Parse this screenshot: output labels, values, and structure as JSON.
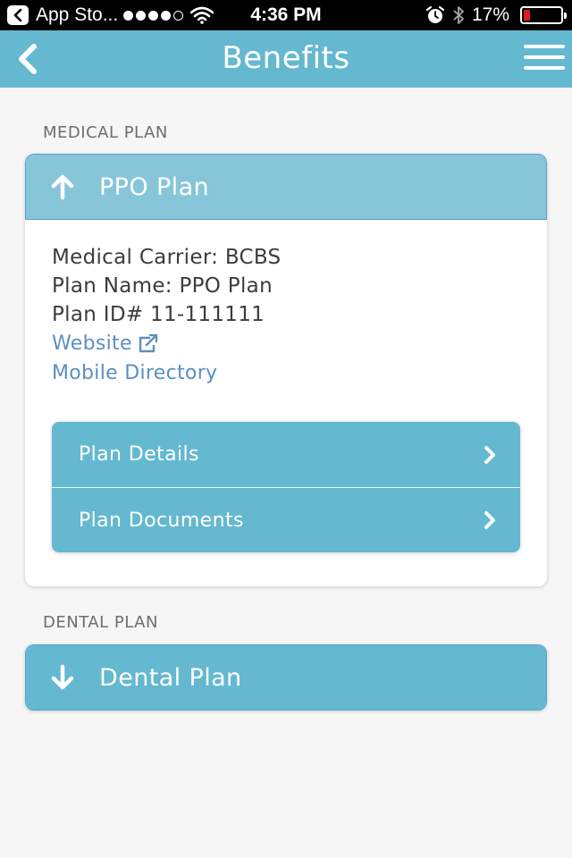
{
  "status_bar": {
    "back_app": "App Sto...",
    "time": "4:36 PM",
    "battery_text": "17%",
    "battery_level": 0.17,
    "signal_bars_filled": 4,
    "signal_bars_total": 5,
    "icons": [
      "back-arrow-icon",
      "wifi-icon",
      "alarm-icon",
      "bluetooth-icon",
      "battery-icon"
    ]
  },
  "nav": {
    "title": "Benefits",
    "back_icon": "chevron-left-icon",
    "menu_icon": "hamburger-menu-icon"
  },
  "medical": {
    "section_label": "MEDICAL PLAN",
    "header": "PPO Plan",
    "header_icon": "arrow-up-icon",
    "carrier": "Medical Carrier: BCBS",
    "plan_name": "Plan Name: PPO Plan",
    "plan_id": "Plan ID# 11-111111",
    "website_link": "Website",
    "website_icon": "external-link-icon",
    "mobile_directory_link": "Mobile Directory",
    "actions": [
      {
        "label": "Plan Details",
        "icon": "chevron-right-icon"
      },
      {
        "label": "Plan Documents",
        "icon": "chevron-right-icon"
      }
    ]
  },
  "dental": {
    "section_label": "DENTAL PLAN",
    "header": "Dental Plan",
    "header_icon": "arrow-down-icon"
  },
  "colors": {
    "nav_bar": "#64b8cf",
    "medical_header": "#86c6d8",
    "action_row": "#64b8cf",
    "link": "#5a8fc4",
    "battery_low": "#e11b1b"
  }
}
